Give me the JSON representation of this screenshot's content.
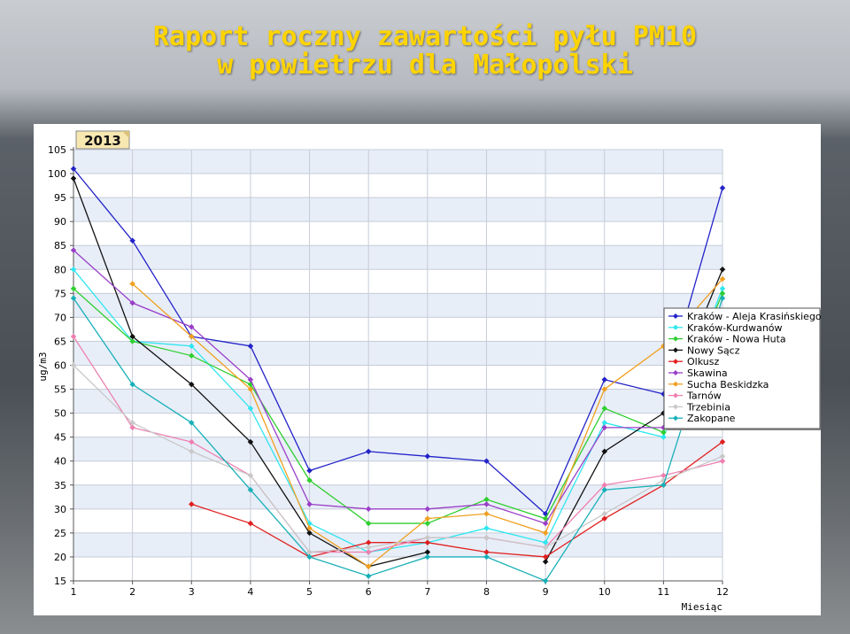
{
  "title_line1": "Raport roczny zawartości pyłu PM10",
  "title_line2": "w powietrzu dla Małopolski",
  "chart_data": {
    "type": "line",
    "year_badge": "2013",
    "ylabel": "ug/m3",
    "xlabel": "Miesiąc",
    "x": [
      1,
      2,
      3,
      4,
      5,
      6,
      7,
      8,
      9,
      10,
      11,
      12
    ],
    "ylim": [
      15,
      105
    ],
    "yticks": [
      15,
      20,
      25,
      30,
      35,
      40,
      45,
      50,
      55,
      60,
      65,
      70,
      75,
      80,
      85,
      90,
      95,
      100,
      105
    ],
    "grid": true,
    "legend_position": "right",
    "series": [
      {
        "name": "Kraków - Aleja Krasińskiego",
        "color": "#2323c8",
        "values": [
          101,
          86,
          66,
          64,
          38,
          42,
          41,
          40,
          29,
          57,
          54,
          97
        ]
      },
      {
        "name": "Kraków-Kurdwanów",
        "color": "#2ee6f0",
        "values": [
          80,
          65,
          64,
          51,
          27,
          21,
          23,
          26,
          23,
          48,
          45,
          76
        ]
      },
      {
        "name": "Kraków - Nowa Huta",
        "color": "#2fcf2f",
        "values": [
          76,
          65,
          62,
          56,
          36,
          27,
          27,
          32,
          28,
          51,
          46,
          75
        ]
      },
      {
        "name": "Nowy Sącz",
        "color": "#111111",
        "values": [
          99,
          66,
          56,
          44,
          25,
          18,
          21,
          null,
          19,
          42,
          50,
          80
        ]
      },
      {
        "name": "Olkusz",
        "color": "#e02020",
        "values": [
          null,
          null,
          31,
          27,
          20,
          23,
          23,
          21,
          20,
          28,
          35,
          44
        ]
      },
      {
        "name": "Skawina",
        "color": "#9a3fc8",
        "values": [
          84,
          73,
          68,
          57,
          31,
          30,
          30,
          31,
          27,
          47,
          47,
          71
        ]
      },
      {
        "name": "Sucha Beskidzka",
        "color": "#f0a020",
        "values": [
          null,
          77,
          66,
          55,
          26,
          18,
          28,
          29,
          25,
          55,
          64,
          78
        ]
      },
      {
        "name": "Tarnów",
        "color": "#ee80b0",
        "values": [
          66,
          47,
          44,
          37,
          21,
          21,
          24,
          24,
          22,
          35,
          37,
          40
        ]
      },
      {
        "name": "Trzebinia",
        "color": "#c8c8c8",
        "values": [
          60,
          48,
          42,
          37,
          21,
          22,
          24,
          24,
          22,
          29,
          36,
          41
        ]
      },
      {
        "name": "Zakopane",
        "color": "#18b0b8",
        "values": [
          74,
          56,
          48,
          34,
          20,
          16,
          20,
          20,
          15,
          34,
          35,
          74
        ]
      }
    ]
  }
}
